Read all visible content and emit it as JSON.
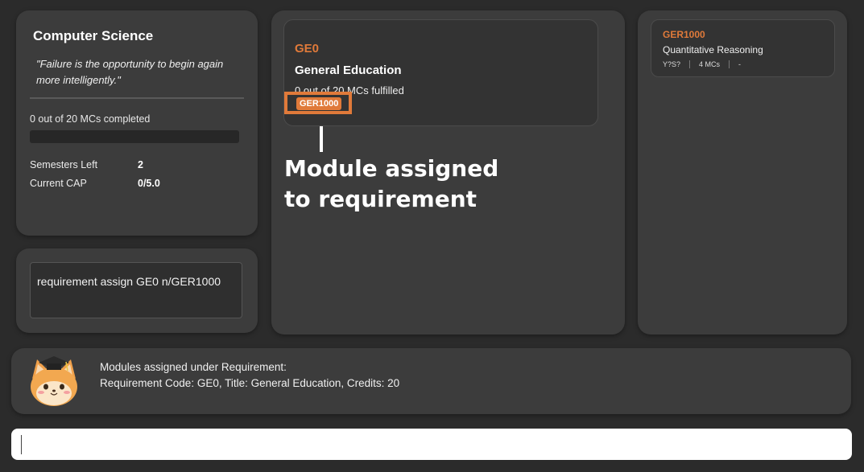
{
  "profile": {
    "course": "Computer Science",
    "quote": "\"Failure is the opportunity to begin again more intelligently.\"",
    "progress_text": "0 out of 20 MCs completed",
    "progress_fraction": 0,
    "semesters_left_label": "Semesters Left",
    "semesters_left_value": "2",
    "cap_label": "Current CAP",
    "cap_value": "0/5.0"
  },
  "command_echo": "requirement assign GE0 n/GER1000",
  "requirement": {
    "code": "GE0",
    "title": "General Education",
    "progress": "0 out of 20 MCs fulfilled",
    "module_tag": "GER1000"
  },
  "callout": {
    "line1": "Module assigned",
    "line2": "to requirement"
  },
  "module": {
    "code": "GER1000",
    "title": "Quantitative Reasoning",
    "semester": "Y?S?",
    "credits": "4 MCs",
    "grade": "-"
  },
  "result": {
    "line1": "Modules assigned under Requirement:",
    "line2": "Requirement Code: GE0, Title: General Education, Credits: 20"
  },
  "command_input": {
    "value": ""
  },
  "colors": {
    "accent": "#e07a3a",
    "panel": "#3c3c3c",
    "background": "#2b2b2b"
  },
  "icons": {
    "mascot": "graduate-fox-mascot-icon"
  }
}
